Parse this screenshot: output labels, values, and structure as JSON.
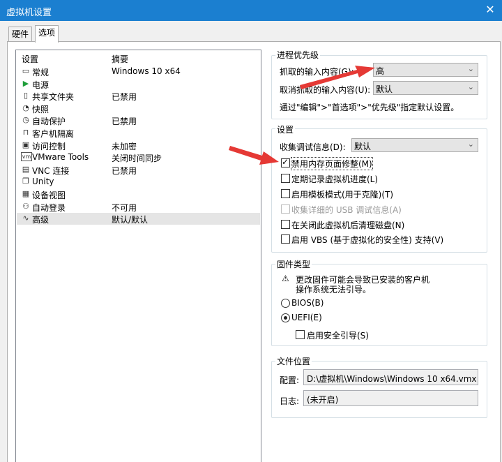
{
  "window": {
    "title": "虚拟机设置",
    "close_glyph": "✕"
  },
  "tabs": [
    {
      "label": "硬件"
    },
    {
      "label": "选项"
    }
  ],
  "list": {
    "col_settings": "设置",
    "col_summary": "摘要",
    "rows": [
      {
        "name": "常规",
        "summary": "Windows 10 x64",
        "icon": "general-icon",
        "glyph": "▭"
      },
      {
        "name": "电源",
        "summary": "",
        "icon": "power-play-icon",
        "glyph": "▶"
      },
      {
        "name": "共享文件夹",
        "summary": "已禁用",
        "icon": "shared-folder-icon",
        "glyph": "▯"
      },
      {
        "name": "快照",
        "summary": "",
        "icon": "snapshot-icon",
        "glyph": "◔"
      },
      {
        "name": "自动保护",
        "summary": "已禁用",
        "icon": "autoprotect-icon",
        "glyph": "◷"
      },
      {
        "name": "客户机隔离",
        "summary": "",
        "icon": "lock-icon",
        "glyph": "⊓"
      },
      {
        "name": "访问控制",
        "summary": "未加密",
        "icon": "access-control-icon",
        "glyph": "▣"
      },
      {
        "name": "VMware Tools",
        "summary": "关闭时间同步",
        "icon": "vmware-tools-icon",
        "glyph": "vm"
      },
      {
        "name": "VNC 连接",
        "summary": "已禁用",
        "icon": "vnc-icon",
        "glyph": "▤"
      },
      {
        "name": "Unity",
        "summary": "",
        "icon": "unity-icon",
        "glyph": "❐"
      },
      {
        "name": "设备视图",
        "summary": "",
        "icon": "device-view-icon",
        "glyph": "▦"
      },
      {
        "name": "自动登录",
        "summary": "不可用",
        "icon": "autologin-icon",
        "glyph": "⚇"
      },
      {
        "name": "高级",
        "summary": "默认/默认",
        "icon": "advanced-icon",
        "glyph": "∿",
        "selected": true
      }
    ]
  },
  "process_priority": {
    "title": "进程优先级",
    "grabbed_label": "抓取的输入内容(G):",
    "grabbed_value": "高",
    "ungrabbed_label": "取消抓取的输入内容(U):",
    "ungrabbed_value": "默认",
    "hint": "通过\"编辑\">\"首选项\">\"优先级\"指定默认设置。"
  },
  "settings": {
    "title": "设置",
    "debug_label": "收集调试信息(D):",
    "debug_value": "默认",
    "checkboxes": [
      {
        "label": "禁用内存页面修整(M)",
        "checked": true,
        "disabled": false
      },
      {
        "label": "定期记录虚拟机进度(L)",
        "checked": false,
        "disabled": false
      },
      {
        "label": "启用模板模式(用于克隆)(T)",
        "checked": false,
        "disabled": false
      },
      {
        "label": "收集详细的 USB 调试信息(A)",
        "checked": false,
        "disabled": true
      },
      {
        "label": "在关闭此虚拟机后清理磁盘(N)",
        "checked": false,
        "disabled": false
      },
      {
        "label": "启用 VBS (基于虚拟化的安全性) 支持(V)",
        "checked": false,
        "disabled": false
      }
    ]
  },
  "firmware": {
    "title": "固件类型",
    "warning_line1": "更改固件可能会导致已安装的客户机",
    "warning_line2": "操作系统无法引导。",
    "bios_label": "BIOS(B)",
    "uefi_label": "UEFI(E)",
    "selected": "UEFI",
    "secure_boot_label": "启用安全引导(S)",
    "secure_boot_checked": false
  },
  "file_location": {
    "title": "文件位置",
    "config_label": "配置:",
    "config_value": "D:\\虚拟机\\Windows\\Windows 10 x64.vmx",
    "log_label": "日志:",
    "log_value": "(未开启)"
  },
  "colors": {
    "accent": "#1b7fd0",
    "annotation_arrow": "#e53935"
  }
}
